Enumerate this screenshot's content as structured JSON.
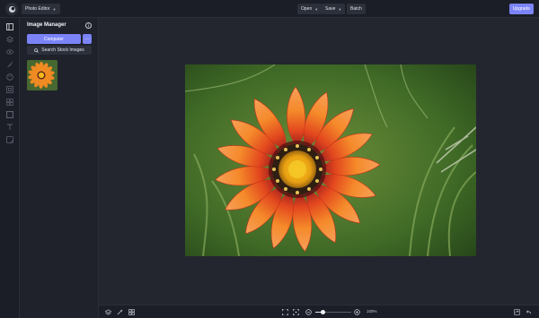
{
  "topbar": {
    "app_menu_label": "Photo Editor",
    "open_label": "Open",
    "save_label": "Save",
    "batch_label": "Batch",
    "upgrade_label": "Upgrade",
    "accent_color": "#7b83f7"
  },
  "rail": {
    "items": [
      {
        "icon": "image-manager-icon",
        "active": true
      },
      {
        "icon": "layers-icon",
        "active": false
      },
      {
        "icon": "eye-icon",
        "active": false
      },
      {
        "icon": "brush-icon",
        "active": false
      },
      {
        "icon": "palette-icon",
        "active": false
      },
      {
        "icon": "frames-icon",
        "active": false
      },
      {
        "icon": "grid-icon",
        "active": false
      },
      {
        "icon": "frame-icon",
        "active": false
      },
      {
        "icon": "text-icon",
        "active": false
      },
      {
        "icon": "sticker-icon",
        "active": false
      }
    ]
  },
  "panel": {
    "title": "Image Manager",
    "computer_label": "Computer",
    "more_label": "···",
    "stock_label": "Search Stock Images"
  },
  "bottombar": {
    "zoom_value": "100%",
    "zoom_level": 0.2
  }
}
